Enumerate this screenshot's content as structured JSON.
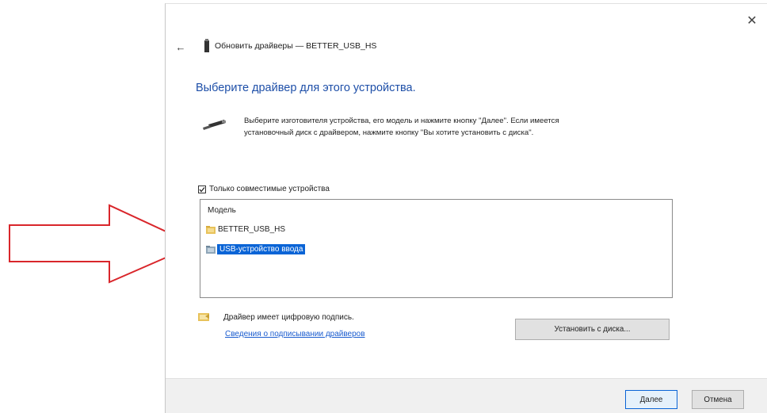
{
  "window": {
    "title": "Обновить драйверы — BETTER_USB_HS",
    "close_glyph": "✕",
    "back_glyph": "←"
  },
  "heading": "Выберите драйвер для этого устройства.",
  "instructions": {
    "line1": "Выберите изготовителя устройства, его модель и нажмите кнопку \"Далее\". Если имеется",
    "line2": "установочный диск с драйвером, нажмите кнопку \"Вы хотите установить с диска\"."
  },
  "compatible_checkbox": {
    "label": "Только совместимые устройства",
    "checked": true
  },
  "model_list": {
    "header": "Модель",
    "items": [
      {
        "label": "BETTER_USB_HS",
        "selected": false,
        "icon": "driver-folder-icon"
      },
      {
        "label": "USB-устройство ввода",
        "selected": true,
        "icon": "driver-folder-icon"
      }
    ]
  },
  "signature": {
    "text": "Драйвер имеет цифровую подпись.",
    "link": "Сведения о подписывании драйверов",
    "icon": "signed-driver-icon"
  },
  "buttons": {
    "have_disk": "Установить с диска...",
    "next": "Далее",
    "cancel": "Отмена"
  },
  "colors": {
    "heading": "#1e4fa8",
    "selection": "#0a64d6",
    "link": "#1a5ccf",
    "arrow": "#d9262b"
  }
}
